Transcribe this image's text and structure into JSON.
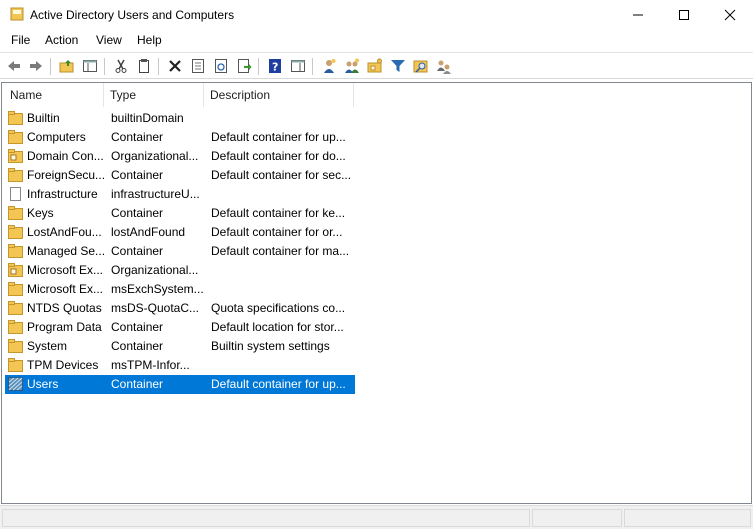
{
  "window": {
    "title": "Active Directory Users and Computers",
    "icon": "folder-app-icon"
  },
  "menu": [
    "File",
    "Action",
    "View",
    "Help"
  ],
  "toolbar": {
    "buttons": [
      "back-icon",
      "forward-icon",
      "up-folder-icon",
      "show-console-tree-icon",
      "cut-icon",
      "copy-icon",
      "delete-icon",
      "properties-icon",
      "refresh-icon",
      "export-list-icon",
      "help-icon",
      "show-action-pane-icon",
      "new-user-icon",
      "new-group-icon",
      "new-ou-icon",
      "filter-icon",
      "find-icon",
      "add-to-group-icon"
    ]
  },
  "columns": [
    "Name",
    "Type",
    "Description"
  ],
  "rows": [
    {
      "name": "Builtin",
      "type": "builtinDomain",
      "description": "",
      "icon": "folder-icon"
    },
    {
      "name": "Computers",
      "type": "Container",
      "description": "Default container for up...",
      "icon": "folder-icon"
    },
    {
      "name": "Domain Con...",
      "type": "Organizational...",
      "description": "Default container for do...",
      "icon": "ou-icon"
    },
    {
      "name": "ForeignSecu...",
      "type": "Container",
      "description": "Default container for sec...",
      "icon": "folder-icon"
    },
    {
      "name": "Infrastructure",
      "type": "infrastructureU...",
      "description": "",
      "icon": "document-icon"
    },
    {
      "name": "Keys",
      "type": "Container",
      "description": "Default container for ke...",
      "icon": "folder-icon"
    },
    {
      "name": "LostAndFou...",
      "type": "lostAndFound",
      "description": "Default container for or...",
      "icon": "folder-icon"
    },
    {
      "name": "Managed Se...",
      "type": "Container",
      "description": "Default container for ma...",
      "icon": "folder-icon"
    },
    {
      "name": "Microsoft Ex...",
      "type": "Organizational...",
      "description": "",
      "icon": "ou-icon"
    },
    {
      "name": "Microsoft Ex...",
      "type": "msExchSystem...",
      "description": "",
      "icon": "folder-icon"
    },
    {
      "name": "NTDS Quotas",
      "type": "msDS-QuotaC...",
      "description": "Quota specifications co...",
      "icon": "folder-icon"
    },
    {
      "name": "Program Data",
      "type": "Container",
      "description": "Default location for stor...",
      "icon": "folder-icon"
    },
    {
      "name": "System",
      "type": "Container",
      "description": "Builtin system settings",
      "icon": "folder-icon"
    },
    {
      "name": "TPM Devices",
      "type": "msTPM-Infor...",
      "description": "",
      "icon": "folder-icon"
    },
    {
      "name": "Users",
      "type": "Container",
      "description": "Default container for up...",
      "icon": "folder-selected-icon",
      "selected": true
    }
  ],
  "colors": {
    "selection": "#0078d7",
    "folder": "#f3c654"
  }
}
